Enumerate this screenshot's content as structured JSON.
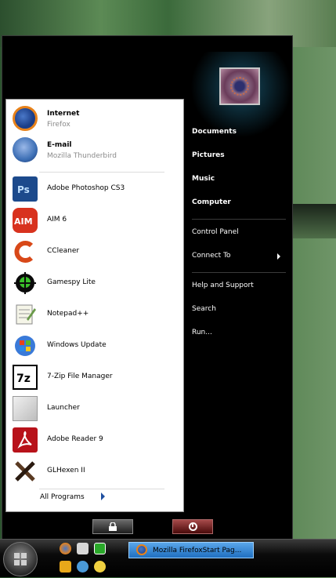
{
  "pinned": [
    {
      "title": "Internet",
      "subtitle": "Firefox",
      "icon": "firefox-icon",
      "color": "#e8821a"
    },
    {
      "title": "E-mail",
      "subtitle": "Mozilla Thunderbird",
      "icon": "thunderbird-icon",
      "color": "#3d6fb5"
    }
  ],
  "recent": [
    {
      "label": "Adobe Photoshop CS3",
      "icon": "photoshop-icon",
      "color": "#1c4a8c"
    },
    {
      "label": "AIM 6",
      "icon": "aim-icon",
      "color": "#d8321e"
    },
    {
      "label": "CCleaner",
      "icon": "ccleaner-icon",
      "color": "#d84818"
    },
    {
      "label": "Gamespy Lite",
      "icon": "gamespy-icon",
      "color": "#1c6e1c"
    },
    {
      "label": "Notepad++",
      "icon": "notepad-icon",
      "color": "#6a9a4a"
    },
    {
      "label": "Windows Update",
      "icon": "windows-update-icon",
      "color": "#3a7ad8"
    },
    {
      "label": "7-Zip File Manager",
      "icon": "seven-zip-icon",
      "color": "#000000"
    },
    {
      "label": "Launcher",
      "icon": "launcher-icon",
      "color": "#bdbdbd"
    },
    {
      "label": "Adobe Reader 9",
      "icon": "adobe-reader-icon",
      "color": "#b8121a"
    },
    {
      "label": "GLHexen II",
      "icon": "glhexen-icon",
      "color": "#5a3a22"
    }
  ],
  "all_programs": "All Programs",
  "right_menu": {
    "documents": "Documents",
    "pictures": "Pictures",
    "music": "Music",
    "computer": "Computer",
    "control_panel": "Control Panel",
    "connect_to": "Connect To",
    "help": "Help and Support",
    "search": "Search",
    "run": "Run..."
  },
  "taskbar": {
    "active_task": "Mozilla FirefoxStart Pag..."
  }
}
